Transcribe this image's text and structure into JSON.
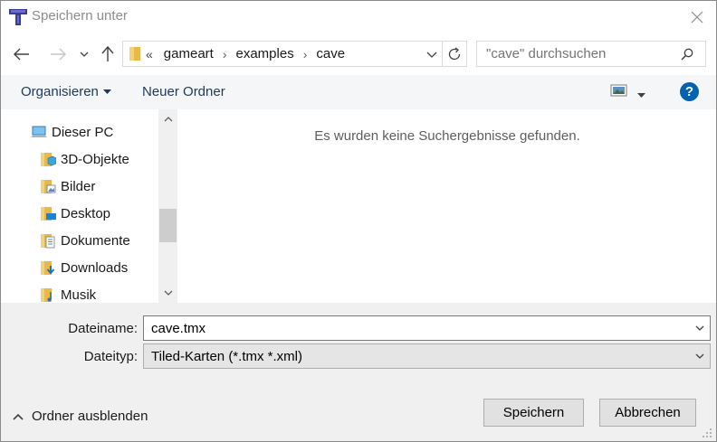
{
  "window": {
    "title": "Speichern unter"
  },
  "address": {
    "overflow": "«",
    "crumbs": [
      "gameart",
      "examples",
      "cave"
    ]
  },
  "search": {
    "placeholder": "\"cave\" durchsuchen"
  },
  "toolbar": {
    "organize_label": "Organisieren",
    "new_folder_label": "Neuer Ordner",
    "help_label": "?"
  },
  "navpane": {
    "items": [
      {
        "label": "Dieser PC",
        "icon": "computer-icon"
      },
      {
        "label": "3D-Objekte",
        "icon": "3d-objects-folder-icon"
      },
      {
        "label": "Bilder",
        "icon": "pictures-folder-icon"
      },
      {
        "label": "Desktop",
        "icon": "desktop-folder-icon"
      },
      {
        "label": "Dokumente",
        "icon": "documents-folder-icon"
      },
      {
        "label": "Downloads",
        "icon": "downloads-folder-icon"
      },
      {
        "label": "Musik",
        "icon": "music-folder-icon"
      }
    ]
  },
  "content": {
    "empty_message": "Es wurden keine Suchergebnisse gefunden."
  },
  "form": {
    "filename_label": "Dateiname:",
    "filename_value": "cave.tmx",
    "filetype_label": "Dateityp:",
    "filetype_value": "Tiled-Karten (*.tmx *.xml)"
  },
  "footer": {
    "hide_folders_label": "Ordner ausblenden",
    "save_label": "Speichern",
    "cancel_label": "Abbrechen"
  },
  "colors": {
    "accent": "#0063b1",
    "folder": "#e8b84a",
    "toolbar_text": "#1e395b"
  }
}
